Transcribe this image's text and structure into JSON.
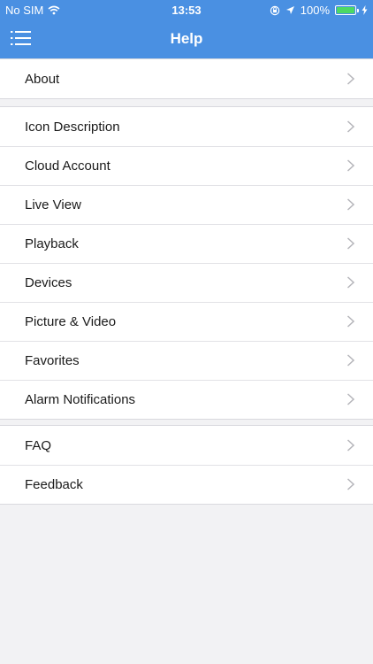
{
  "status": {
    "carrier": "No SIM",
    "time": "13:53",
    "battery": "100%",
    "battery_level": 1.0,
    "battery_color": "#4cd964"
  },
  "header": {
    "title": "Help",
    "menu_icon": "menu-icon",
    "color": "#4a90e2"
  },
  "sections": [
    {
      "items": [
        {
          "label": "About"
        }
      ]
    },
    {
      "items": [
        {
          "label": "Icon Description"
        },
        {
          "label": "Cloud Account"
        },
        {
          "label": "Live View"
        },
        {
          "label": "Playback"
        },
        {
          "label": "Devices"
        },
        {
          "label": "Picture & Video"
        },
        {
          "label": "Favorites"
        },
        {
          "label": "Alarm Notifications"
        }
      ]
    },
    {
      "items": [
        {
          "label": "FAQ"
        },
        {
          "label": "Feedback"
        }
      ]
    }
  ]
}
